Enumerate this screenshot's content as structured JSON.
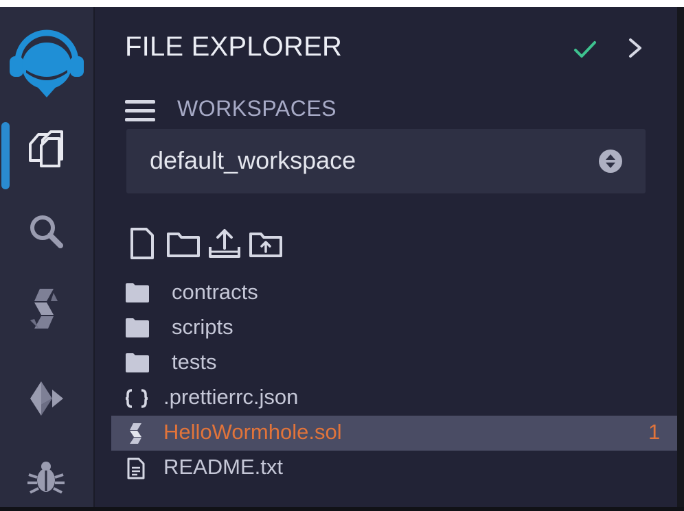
{
  "panel": {
    "title": "FILE EXPLORER",
    "workspaces_label": "WORKSPACES",
    "workspace_selected": "default_workspace"
  },
  "icon_bar": {
    "items": [
      {
        "icon": "remix-logo-icon"
      },
      {
        "icon": "file-explorer-icon",
        "active": true
      },
      {
        "icon": "search-icon"
      },
      {
        "icon": "solidity-compiler-icon"
      },
      {
        "icon": "deploy-run-icon"
      },
      {
        "icon": "debugger-icon"
      }
    ]
  },
  "toolbar": [
    "new-file-icon",
    "new-folder-icon",
    "publish-gist-icon",
    "upload-files-icon"
  ],
  "tree": [
    {
      "label": "contracts",
      "type": "folder"
    },
    {
      "label": "scripts",
      "type": "folder"
    },
    {
      "label": "tests",
      "type": "folder"
    },
    {
      "label": ".prettierrc.json",
      "type": "json"
    },
    {
      "label": "HelloWormhole.sol",
      "type": "solidity",
      "selected": true,
      "badge": "1"
    },
    {
      "label": "README.txt",
      "type": "text"
    }
  ],
  "colors": {
    "accent": "#2a8bd0",
    "selected_text": "#e2743a",
    "check": "#3ec28f",
    "background": "#222336",
    "sidebar": "#2a2c3f"
  }
}
